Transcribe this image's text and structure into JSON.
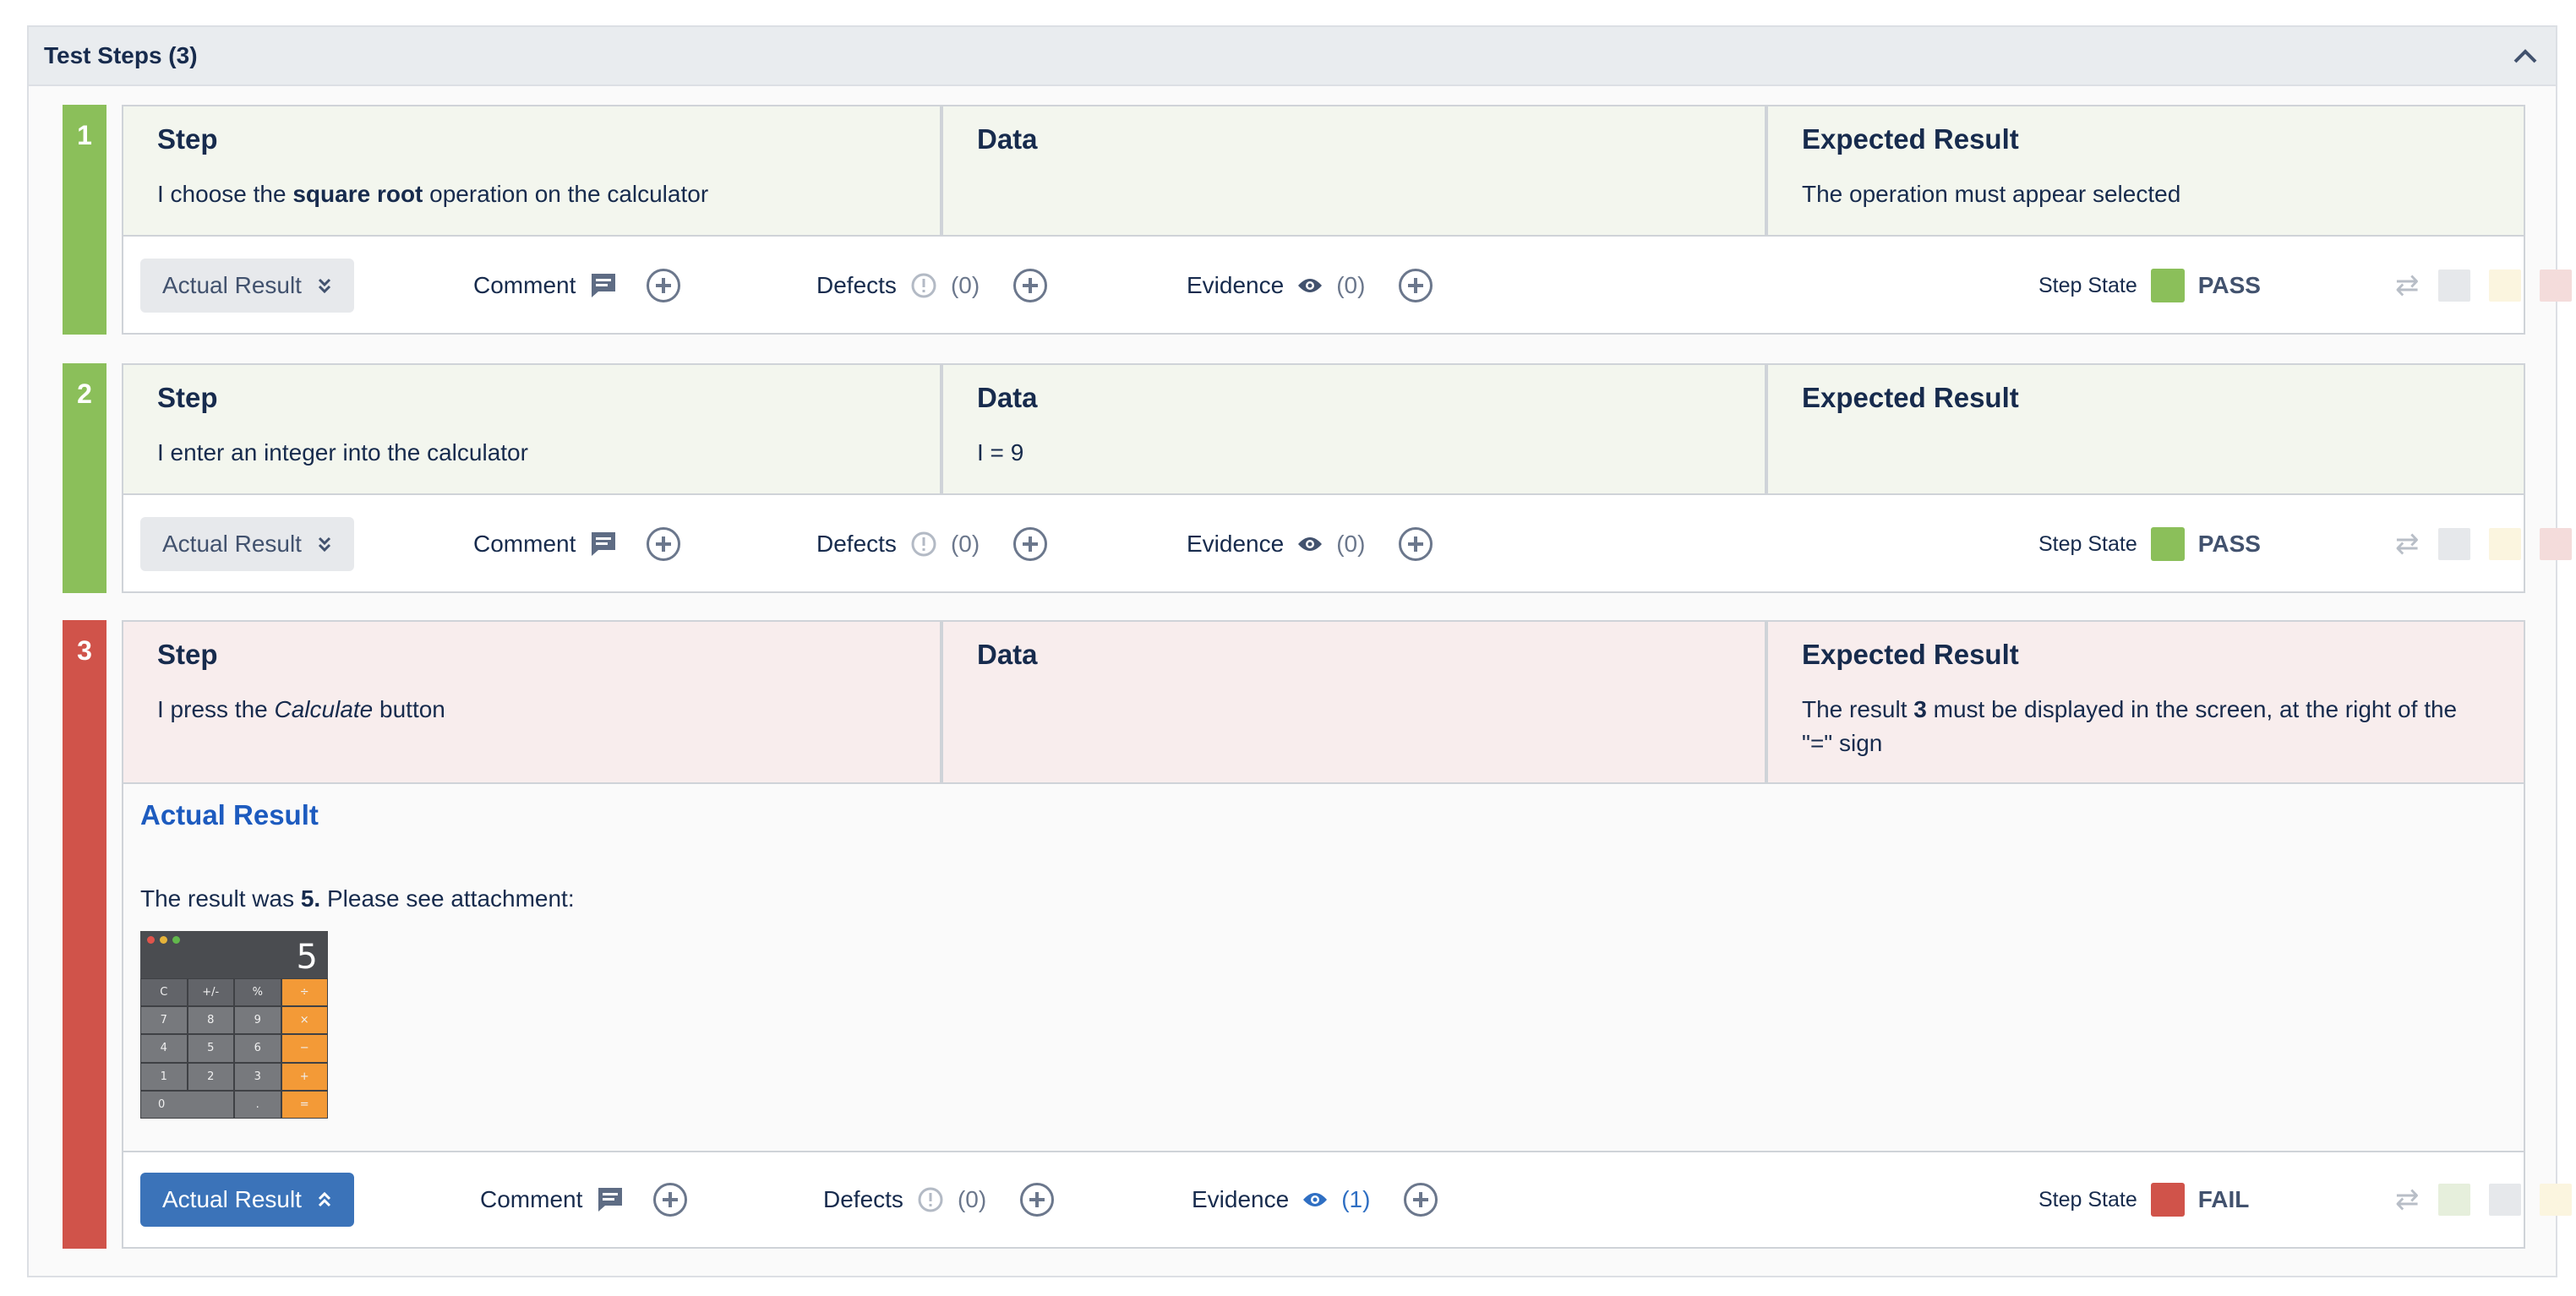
{
  "panel": {
    "title": "Test Steps (3)",
    "collapse_icon": "chevron-up-icon"
  },
  "columns": {
    "step": "Step",
    "data": "Data",
    "expected": "Expected Result"
  },
  "toolbar": {
    "actual_result": "Actual Result",
    "comment": "Comment",
    "defects": "Defects",
    "evidence": "Evidence",
    "step_state": "Step State"
  },
  "steps": [
    {
      "number": "1",
      "step_parts": [
        "I choose the ",
        "square root",
        " operation on the calculator"
      ],
      "data": "",
      "expected": "The operation must appear selected",
      "defects_count": "(0)",
      "evidence_count": "(0)",
      "state": "PASS",
      "state_color": "#8bbf5a"
    },
    {
      "number": "2",
      "step_text": "I enter an integer into the calculator",
      "data": "I = 9",
      "expected": "",
      "defects_count": "(0)",
      "evidence_count": "(0)",
      "state": "PASS",
      "state_color": "#8bbf5a"
    },
    {
      "number": "3",
      "step_parts": [
        "I press the ",
        "Calculate",
        " button"
      ],
      "data": "",
      "expected_parts": [
        "The result ",
        "3",
        " must be displayed in the screen, at the right of the \"=\" sign"
      ],
      "actual_title": "Actual Result",
      "actual_parts": [
        "The result was ",
        "5.",
        " Please see attachment:"
      ],
      "calc_display": "5",
      "calc_keys": [
        "C",
        "+/-",
        "%",
        "÷",
        "7",
        "8",
        "9",
        "×",
        "4",
        "5",
        "6",
        "−",
        "1",
        "2",
        "3",
        "+",
        "0",
        ".",
        "="
      ],
      "defects_count": "(0)",
      "evidence_count": "(1)",
      "state": "FAIL",
      "state_color": "#d0534a"
    }
  ],
  "colors": {
    "pass": "#8bbf5a",
    "fail": "#d0534a",
    "pass_bg": "#f3f6ee",
    "fail_bg": "#f8eded",
    "link_blue": "#2f6fc3"
  }
}
